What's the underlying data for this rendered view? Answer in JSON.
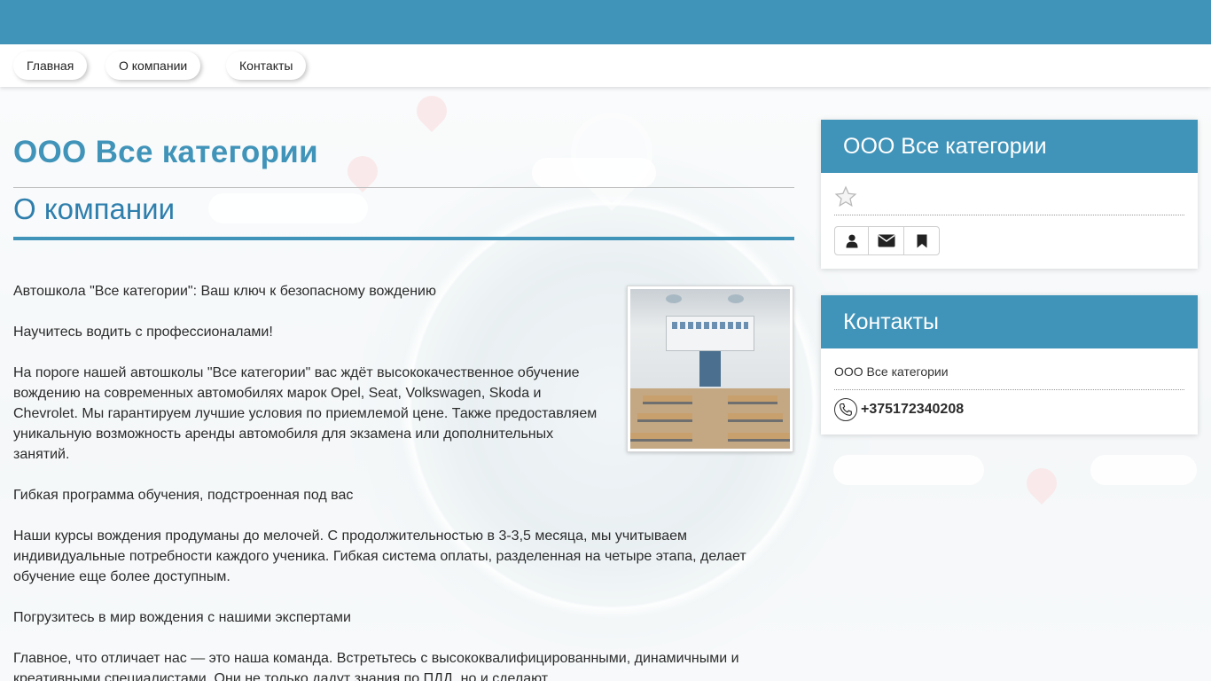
{
  "nav": {
    "items": [
      "Главная",
      "О компании",
      "Контакты"
    ]
  },
  "main": {
    "company_title": "ООО Все категории",
    "section_title": "О компании",
    "paragraphs": [
      "Автошкола \"Все категории\": Ваш ключ к безопасному вождению",
      "Научитесь водить с профессионалами!",
      "На пороге нашей автошколы \"Все категории\" вас ждёт высококачественное обучение вождению на современных автомобилях марок Opel, Seat, Volkswagen, Skoda и Chevrolet. Мы гарантируем лучшие условия по приемлемой цене. Также предоставляем уникальную возможность аренды автомобиля для экзамена или дополнительных занятий.",
      "Гибкая программа обучения, подстроенная под вас",
      "Наши курсы вождения продуманы до мелочей. С продолжительностью в 3-3,5 месяца, мы учитываем индивидуальные потребности каждого ученика. Гибкая система оплаты, разделенная на четыре этапа, делает обучение еще более доступным.",
      "Погрузитесь в мир вождения с нашими экспертами",
      "Главное, что отличает нас — это наша команда. Встретьтесь с высококвалифицированными, динамичными и креативными специалистами. Они не только дадут знания по ПДД, но и сделают"
    ]
  },
  "sidebar": {
    "company_card": {
      "title": "ООО Все категории",
      "rating_icon": "star-icon",
      "actions": [
        "user-icon",
        "envelope-icon",
        "bookmark-icon"
      ]
    },
    "contacts_card": {
      "title": "Контакты",
      "name": "ООО Все категории",
      "phone": "+375172340208"
    }
  },
  "colors": {
    "accent": "#4194b9",
    "section_title": "#2f7fad"
  }
}
